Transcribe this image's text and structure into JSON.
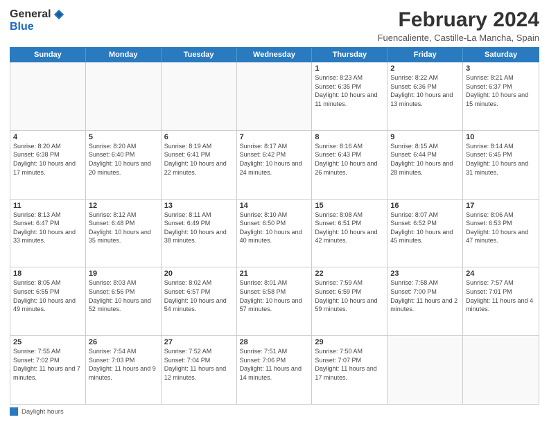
{
  "logo": {
    "general": "General",
    "blue": "Blue"
  },
  "title": "February 2024",
  "location": "Fuencaliente, Castille-La Mancha, Spain",
  "header_days": [
    "Sunday",
    "Monday",
    "Tuesday",
    "Wednesday",
    "Thursday",
    "Friday",
    "Saturday"
  ],
  "weeks": [
    [
      {
        "day": "",
        "info": ""
      },
      {
        "day": "",
        "info": ""
      },
      {
        "day": "",
        "info": ""
      },
      {
        "day": "",
        "info": ""
      },
      {
        "day": "1",
        "info": "Sunrise: 8:23 AM\nSunset: 6:35 PM\nDaylight: 10 hours and 11 minutes."
      },
      {
        "day": "2",
        "info": "Sunrise: 8:22 AM\nSunset: 6:36 PM\nDaylight: 10 hours and 13 minutes."
      },
      {
        "day": "3",
        "info": "Sunrise: 8:21 AM\nSunset: 6:37 PM\nDaylight: 10 hours and 15 minutes."
      }
    ],
    [
      {
        "day": "4",
        "info": "Sunrise: 8:20 AM\nSunset: 6:38 PM\nDaylight: 10 hours and 17 minutes."
      },
      {
        "day": "5",
        "info": "Sunrise: 8:20 AM\nSunset: 6:40 PM\nDaylight: 10 hours and 20 minutes."
      },
      {
        "day": "6",
        "info": "Sunrise: 8:19 AM\nSunset: 6:41 PM\nDaylight: 10 hours and 22 minutes."
      },
      {
        "day": "7",
        "info": "Sunrise: 8:17 AM\nSunset: 6:42 PM\nDaylight: 10 hours and 24 minutes."
      },
      {
        "day": "8",
        "info": "Sunrise: 8:16 AM\nSunset: 6:43 PM\nDaylight: 10 hours and 26 minutes."
      },
      {
        "day": "9",
        "info": "Sunrise: 8:15 AM\nSunset: 6:44 PM\nDaylight: 10 hours and 28 minutes."
      },
      {
        "day": "10",
        "info": "Sunrise: 8:14 AM\nSunset: 6:45 PM\nDaylight: 10 hours and 31 minutes."
      }
    ],
    [
      {
        "day": "11",
        "info": "Sunrise: 8:13 AM\nSunset: 6:47 PM\nDaylight: 10 hours and 33 minutes."
      },
      {
        "day": "12",
        "info": "Sunrise: 8:12 AM\nSunset: 6:48 PM\nDaylight: 10 hours and 35 minutes."
      },
      {
        "day": "13",
        "info": "Sunrise: 8:11 AM\nSunset: 6:49 PM\nDaylight: 10 hours and 38 minutes."
      },
      {
        "day": "14",
        "info": "Sunrise: 8:10 AM\nSunset: 6:50 PM\nDaylight: 10 hours and 40 minutes."
      },
      {
        "day": "15",
        "info": "Sunrise: 8:08 AM\nSunset: 6:51 PM\nDaylight: 10 hours and 42 minutes."
      },
      {
        "day": "16",
        "info": "Sunrise: 8:07 AM\nSunset: 6:52 PM\nDaylight: 10 hours and 45 minutes."
      },
      {
        "day": "17",
        "info": "Sunrise: 8:06 AM\nSunset: 6:53 PM\nDaylight: 10 hours and 47 minutes."
      }
    ],
    [
      {
        "day": "18",
        "info": "Sunrise: 8:05 AM\nSunset: 6:55 PM\nDaylight: 10 hours and 49 minutes."
      },
      {
        "day": "19",
        "info": "Sunrise: 8:03 AM\nSunset: 6:56 PM\nDaylight: 10 hours and 52 minutes."
      },
      {
        "day": "20",
        "info": "Sunrise: 8:02 AM\nSunset: 6:57 PM\nDaylight: 10 hours and 54 minutes."
      },
      {
        "day": "21",
        "info": "Sunrise: 8:01 AM\nSunset: 6:58 PM\nDaylight: 10 hours and 57 minutes."
      },
      {
        "day": "22",
        "info": "Sunrise: 7:59 AM\nSunset: 6:59 PM\nDaylight: 10 hours and 59 minutes."
      },
      {
        "day": "23",
        "info": "Sunrise: 7:58 AM\nSunset: 7:00 PM\nDaylight: 11 hours and 2 minutes."
      },
      {
        "day": "24",
        "info": "Sunrise: 7:57 AM\nSunset: 7:01 PM\nDaylight: 11 hours and 4 minutes."
      }
    ],
    [
      {
        "day": "25",
        "info": "Sunrise: 7:55 AM\nSunset: 7:02 PM\nDaylight: 11 hours and 7 minutes."
      },
      {
        "day": "26",
        "info": "Sunrise: 7:54 AM\nSunset: 7:03 PM\nDaylight: 11 hours and 9 minutes."
      },
      {
        "day": "27",
        "info": "Sunrise: 7:52 AM\nSunset: 7:04 PM\nDaylight: 11 hours and 12 minutes."
      },
      {
        "day": "28",
        "info": "Sunrise: 7:51 AM\nSunset: 7:06 PM\nDaylight: 11 hours and 14 minutes."
      },
      {
        "day": "29",
        "info": "Sunrise: 7:50 AM\nSunset: 7:07 PM\nDaylight: 11 hours and 17 minutes."
      },
      {
        "day": "",
        "info": ""
      },
      {
        "day": "",
        "info": ""
      }
    ]
  ],
  "legend": "Daylight hours"
}
